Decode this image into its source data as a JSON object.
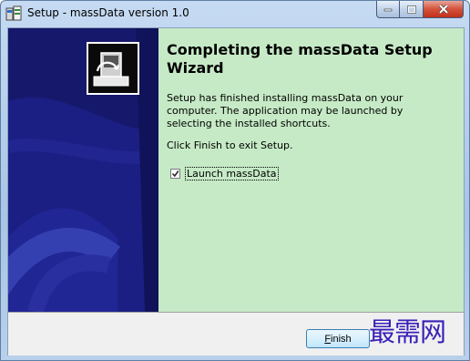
{
  "window": {
    "title": "Setup - massData version 1.0"
  },
  "icons": {
    "app": "installer-app-icon",
    "wizard_logo": "computer-installer-icon",
    "minimize": "minimize-icon",
    "maximize": "maximize-icon",
    "close": "close-icon"
  },
  "content": {
    "heading": "Completing the massData Setup Wizard",
    "description": "Setup has finished installing massData on your computer. The application may be launched by selecting the installed shortcuts.",
    "exit_text": "Click Finish to exit Setup.",
    "launch_checkbox": {
      "label": "Launch massData",
      "checked": true
    }
  },
  "buttons": {
    "finish_first": "F",
    "finish_rest": "inish"
  },
  "watermark": "最需网",
  "colors": {
    "left_panel": "#16186b",
    "right_panel": "#c6eac6",
    "watermark": "#3a1fb7"
  }
}
